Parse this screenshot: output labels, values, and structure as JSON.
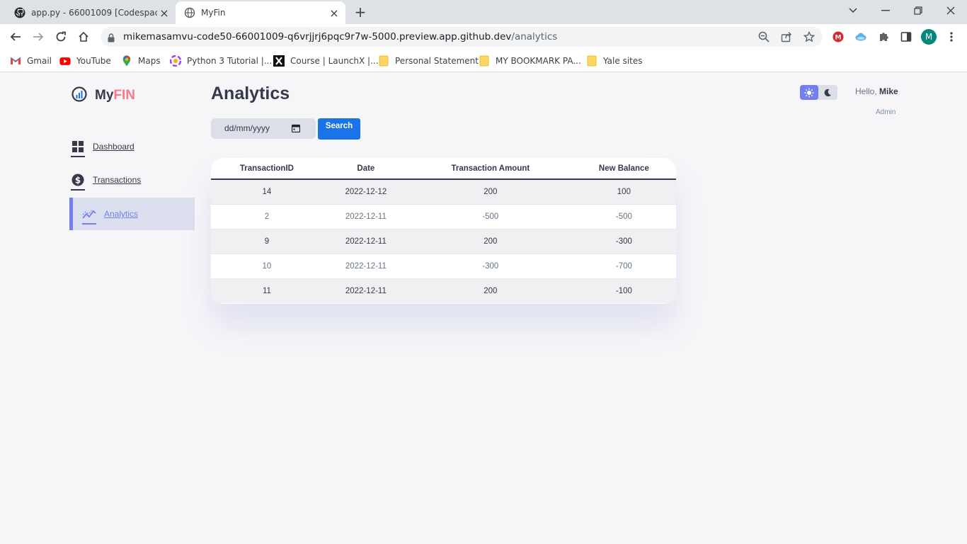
{
  "browser": {
    "tabs": [
      {
        "title": "app.py - 66001009 [Codespaces]",
        "active": false
      },
      {
        "title": "MyFin",
        "active": true
      }
    ],
    "url_host": "mikemasamvu-code50-66001009-q6vrjjrj6pqc9r7w-5000.preview.app.github.dev",
    "url_path": "/analytics",
    "profile_initial": "M",
    "bookmarks": [
      {
        "label": "Gmail",
        "icon": "gmail-icon"
      },
      {
        "label": "YouTube",
        "icon": "youtube-icon"
      },
      {
        "label": "Maps",
        "icon": "maps-icon"
      },
      {
        "label": "Python 3 Tutorial |...",
        "icon": "python-icon"
      },
      {
        "label": "Course | LaunchX |...",
        "icon": "launchx-icon"
      },
      {
        "label": "Personal Statement",
        "icon": "folder-icon"
      },
      {
        "label": "MY BOOKMARK PA...",
        "icon": "folder-icon"
      },
      {
        "label": "Yale sites",
        "icon": "folder-icon"
      }
    ]
  },
  "app": {
    "logo_main": "My",
    "logo_accent": "FIN",
    "accent_color": "#7380ec",
    "sidebar": [
      {
        "label": "Dashboard",
        "icon": "dashboard-icon",
        "active": false
      },
      {
        "label": "Transactions",
        "icon": "dollar-icon",
        "active": false
      },
      {
        "label": "Analytics",
        "icon": "analytics-icon",
        "active": true
      }
    ],
    "page_title": "Analytics",
    "date_placeholder": "dd/mm/yyyy",
    "search_label": "Search",
    "greeting_prefix": "Hello,",
    "user_name": "Mike",
    "user_role": "Admin"
  },
  "table": {
    "headers": [
      "TransactionID",
      "Date",
      "Transaction Amount",
      "New Balance"
    ],
    "rows": [
      [
        "14",
        "2022-12-12",
        "200",
        "100"
      ],
      [
        "2",
        "2022-12-11",
        "-500",
        "-500"
      ],
      [
        "9",
        "2022-12-11",
        "200",
        "-300"
      ],
      [
        "10",
        "2022-12-11",
        "-300",
        "-700"
      ],
      [
        "11",
        "2022-12-11",
        "200",
        "-100"
      ]
    ]
  }
}
